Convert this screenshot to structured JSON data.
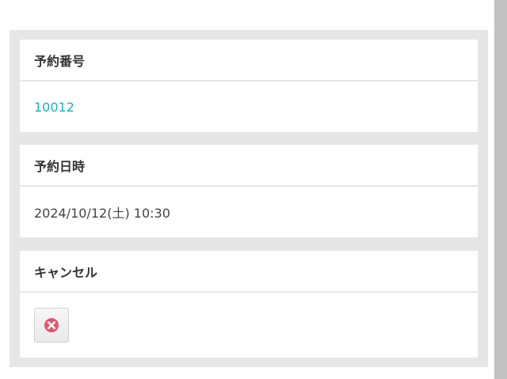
{
  "reservation_number": {
    "label": "予約番号",
    "value": "10012"
  },
  "reservation_datetime": {
    "label": "予約日時",
    "value": "2024/10/12(土) 10:30"
  },
  "cancel": {
    "label": "キャンセル",
    "icon": "cancel-x-icon",
    "icon_color": "#e8546b"
  },
  "colors": {
    "link": "#1ab0c2",
    "panel_bg": "#e6e6e6",
    "scrollbar": "#c1c1c1"
  }
}
